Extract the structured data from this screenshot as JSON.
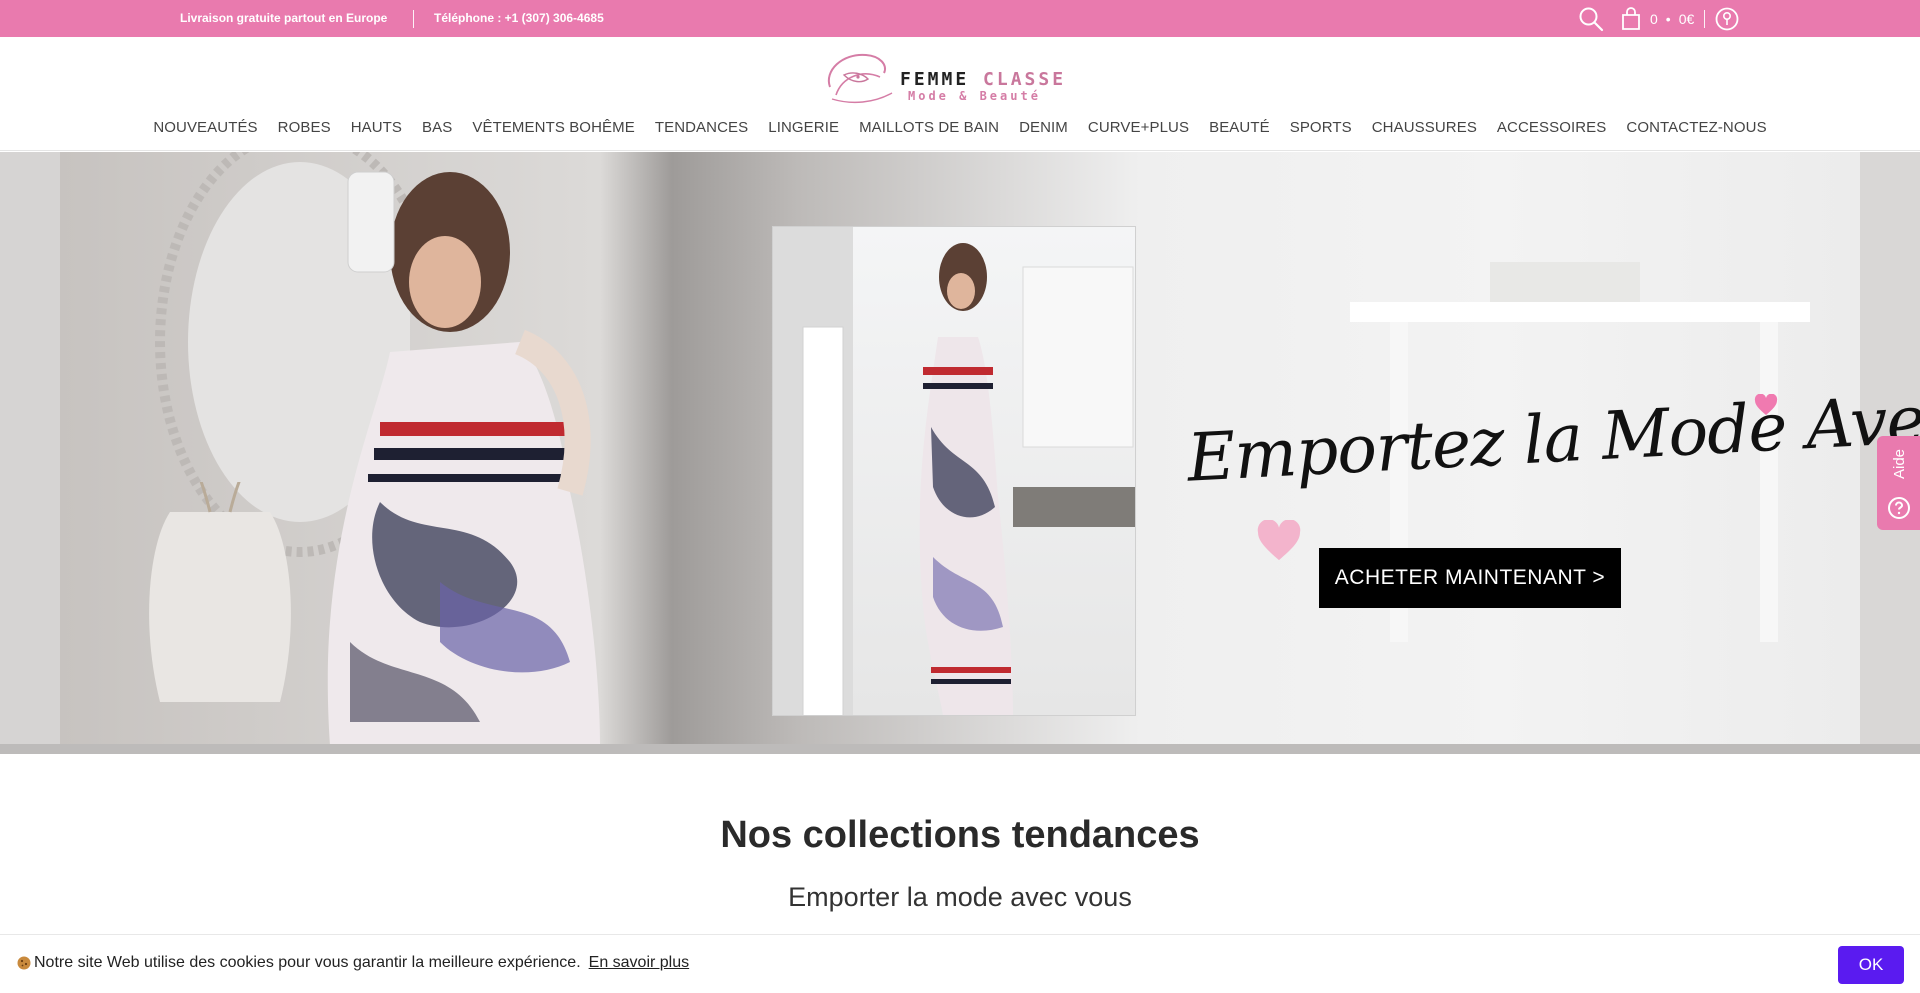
{
  "topbar": {
    "shipping": "Livraison gratuite partout en Europe",
    "phone": "Téléphone : +1 (307) 306-4685",
    "cart_count": "0",
    "cart_total": "0€",
    "background": "#e97aae"
  },
  "logo": {
    "title_left": "FEMME ",
    "title_right": "CLASSE",
    "subtitle": "Mode & Beauté"
  },
  "nav": {
    "items": [
      "NOUVEAUTÉS",
      "ROBES",
      "HAUTS",
      "BAS",
      "VÊTEMENTS BOHÊME",
      "TENDANCES",
      "LINGERIE",
      "MAILLOTS DE BAIN",
      "DENIM",
      "CURVE+PLUS",
      "BEAUTÉ",
      "SPORTS",
      "CHAUSSURES",
      "ACCESSOIRES",
      "CONTACTEZ-NOUS"
    ]
  },
  "hero": {
    "script_text": "Emportez la Mode Avec Vous",
    "cta_label": "ACHETER MAINTENANT >"
  },
  "help": {
    "label": "Aide"
  },
  "collections": {
    "title": "Nos collections tendances",
    "subtitle": "Emporter la mode avec vous"
  },
  "cookie": {
    "message": "Notre site Web utilise des cookies pour vous garantir la meilleure expérience.",
    "link": "En savoir plus",
    "ok": "OK",
    "button_color": "#5a1bf0"
  },
  "icons": [
    "search-icon",
    "cart-icon",
    "account-icon",
    "help-icon",
    "cookie-icon",
    "heart-icon"
  ]
}
